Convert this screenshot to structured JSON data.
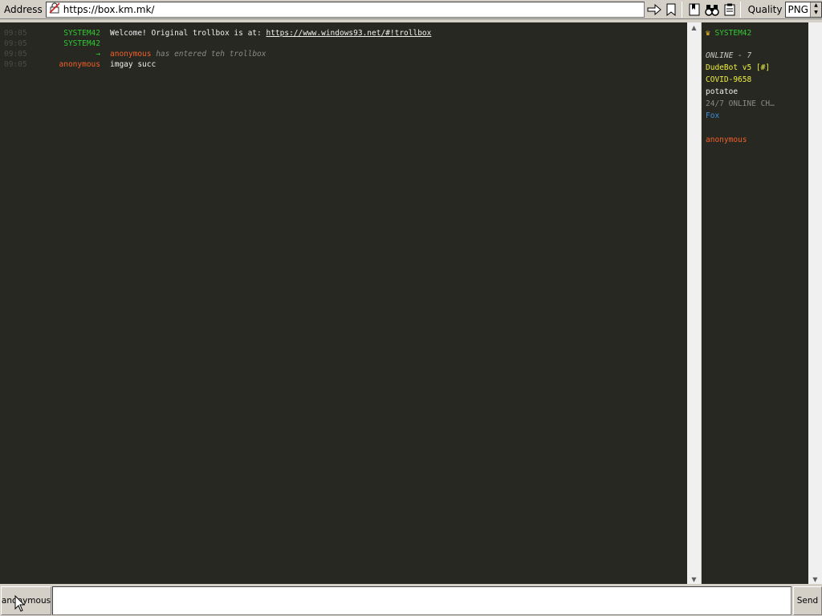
{
  "toolbar": {
    "address_label": "Address",
    "url": "https://box.km.mk/",
    "quality_label": "Quality",
    "quality_value": "PNG"
  },
  "messages": [
    {
      "time": "09:05",
      "nick": "SYSTEM42",
      "nick_color": "#32c832",
      "parts": [
        {
          "text": "Welcome! Original trollbox is at: "
        },
        {
          "text": "https://www.windows93.net/#!trollbox",
          "link": true
        }
      ]
    },
    {
      "time": "09:05",
      "nick": "SYSTEM42",
      "nick_color": "#32c832",
      "parts": []
    },
    {
      "time": "09:05",
      "nick": "→",
      "nick_color": "#32c832",
      "parts": [
        {
          "text": "anonymous",
          "color": "#f0602a"
        },
        {
          "text": " has entered teh trollbox",
          "color": "#8a8a80",
          "italic": true
        }
      ]
    },
    {
      "time": "09:05",
      "nick": "anonymous",
      "nick_color": "#f0602a",
      "parts": [
        {
          "text": "imgay succ"
        }
      ]
    }
  ],
  "userlist": {
    "admin": "SYSTEM42",
    "online_header": "ONLINE - 7",
    "users": [
      {
        "name": "DudeBot v5 [#]",
        "color": "#f0f040"
      },
      {
        "name": "COVID-9658",
        "color": "#f0f040"
      },
      {
        "name": "potatoe",
        "color": "#f0f0f0"
      },
      {
        "name": "24/7 ONLINE CH…",
        "color": "#8a8a80"
      },
      {
        "name": "Fox",
        "color": "#3b8fd8"
      }
    ],
    "self": {
      "name": "anonymous",
      "color": "#f0602a"
    }
  },
  "input": {
    "nick_button": "anonymous",
    "send_button": "Send",
    "message_value": ""
  }
}
